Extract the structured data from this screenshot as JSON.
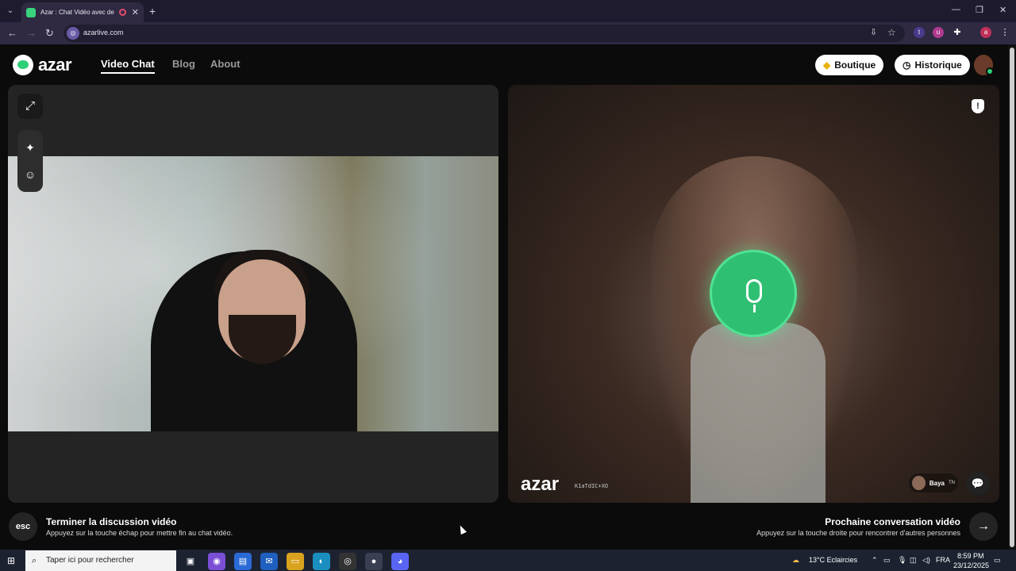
{
  "browser": {
    "tab_title": "Azar : Chat Vidéo avec de n",
    "tab_close": "✕",
    "new_tab": "+",
    "url": "azarlive.com",
    "minimize": "—",
    "restore": "❐",
    "close": "✕"
  },
  "nav": {
    "logo": "azar",
    "items": [
      {
        "label": "Video Chat"
      },
      {
        "label": "Blog"
      },
      {
        "label": "About"
      }
    ],
    "boutique": "Boutique",
    "historique": "Historique"
  },
  "remote": {
    "watermark": "azar",
    "id": "K1aTdIC+XO",
    "peer_name": "Baya",
    "peer_country": "TN"
  },
  "footer": {
    "esc": "esc",
    "left_title": "Terminer la discussion vidéo",
    "left_sub": "Appuyez sur la touche échap pour mettre fin au chat vidéo.",
    "right_title": "Prochaine conversation vidéo",
    "right_sub": "Appuyez sur la touche droite pour rencontrer d'autres personnes",
    "next": "→"
  },
  "taskbar": {
    "search_placeholder": "Taper ici pour rechercher",
    "weather": "13°C  Eclaircies",
    "lang": "FRA",
    "time": "8:59 PM",
    "date": "23/12/2025"
  },
  "colors": {
    "accent": "#2fbf72",
    "bg": "#0b0b0b",
    "panel": "#242424"
  }
}
